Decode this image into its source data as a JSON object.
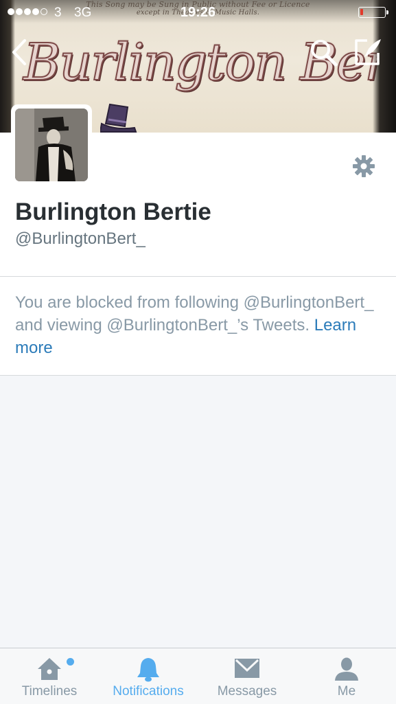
{
  "status_bar": {
    "signal_bars": 4,
    "signal_max": 5,
    "carrier": "3",
    "network": "3G",
    "time": "19:26",
    "battery_level": 0.12,
    "battery_color": "#e23a2b"
  },
  "banner": {
    "fine_print_line1": "This Song may be Sung in Public without Fee or Licence",
    "fine_print_line2": "except in Theatres & Music Halls.",
    "title_art": "Burlington Bertie"
  },
  "nav": {
    "back_icon": "chevron-left-icon",
    "search_icon": "search-icon",
    "compose_icon": "compose-icon"
  },
  "profile": {
    "display_name": "Burlington Bertie",
    "handle": "@BurlingtonBert_",
    "settings_icon": "gear-icon"
  },
  "blocked": {
    "message": "You are blocked from following @BurlingtonBert_ and viewing @BurlingtonBert_’s Tweets.",
    "learn_more": "Learn more"
  },
  "tabs": [
    {
      "label": "Timelines",
      "icon": "home-icon",
      "has_unread": true
    },
    {
      "label": "Notifications",
      "icon": "bell-icon",
      "active": true
    },
    {
      "label": "Messages",
      "icon": "envelope-icon"
    },
    {
      "label": "Me",
      "icon": "person-icon"
    }
  ],
  "colors": {
    "accent": "#55acee",
    "link": "#2b7bb9",
    "muted_text": "#8899a6",
    "name_text": "#292f33"
  }
}
